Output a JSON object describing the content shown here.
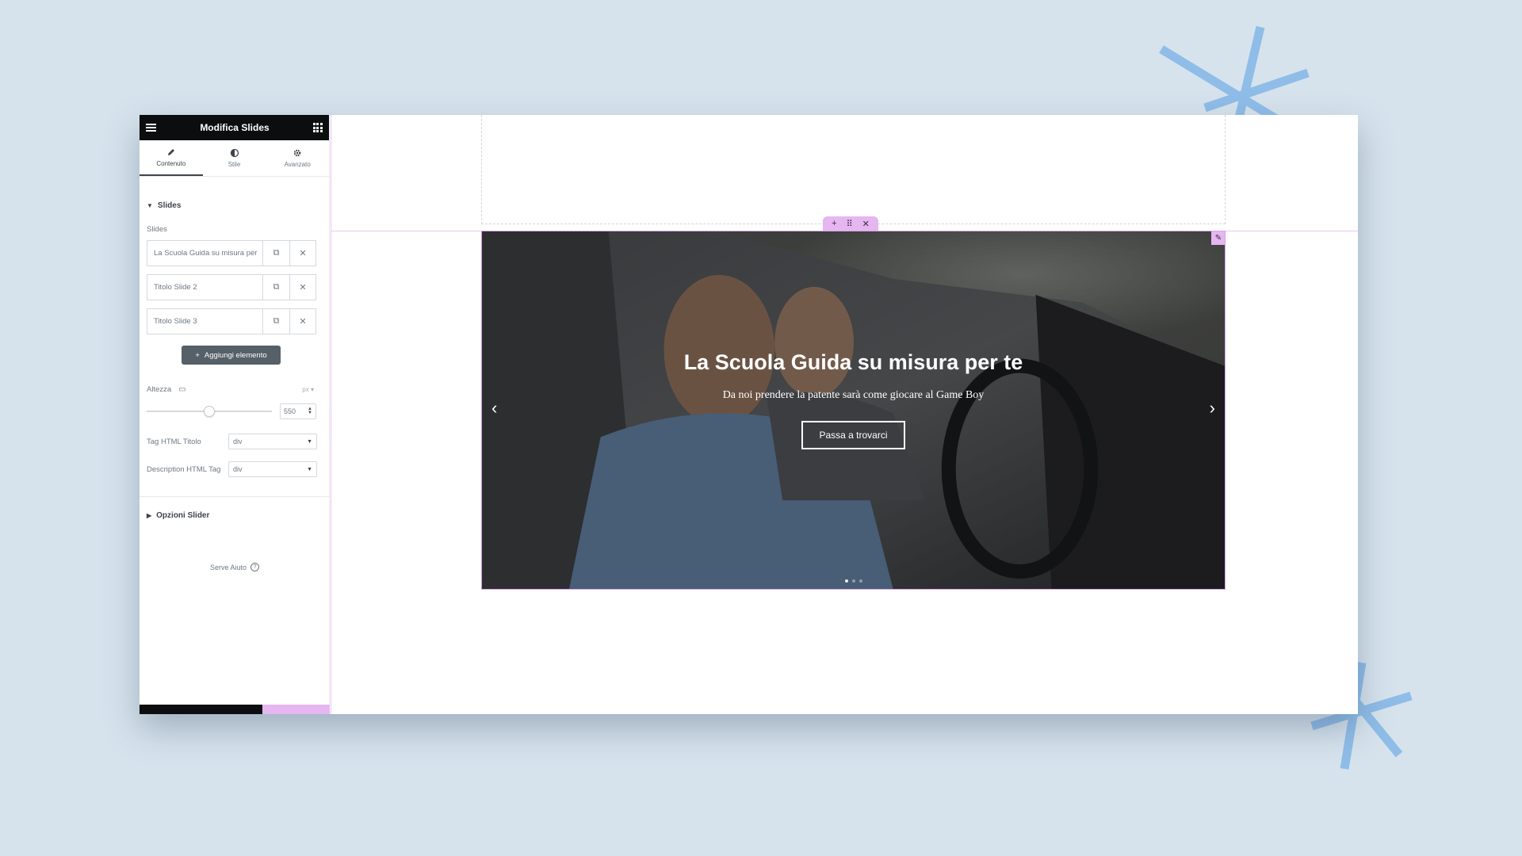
{
  "panel": {
    "title": "Modifica Slides",
    "tabs": [
      {
        "label": "Contenuto",
        "icon": "pencil-icon"
      },
      {
        "label": "Stile",
        "icon": "contrast-icon"
      },
      {
        "label": "Avanzato",
        "icon": "gear-icon"
      }
    ],
    "section_slides": "Slides",
    "slides_label": "Slides",
    "slides": [
      {
        "title": "La Scuola Guida su misura per"
      },
      {
        "title": "Titolo Slide 2"
      },
      {
        "title": "Titolo Slide 3"
      }
    ],
    "add_button": "Aggiungi elemento",
    "height_label": "Altezza",
    "height_unit": "px",
    "height_value": "550",
    "height_fraction": 0.5,
    "title_tag_label": "Tag HTML Titolo",
    "title_tag_value": "div",
    "desc_tag_label": "Description HTML Tag",
    "desc_tag_value": "div",
    "section_slider_options": "Opzioni Slider",
    "help_label": "Serve Aiuto"
  },
  "slide": {
    "heading": "La Scuola Guida su misura per te",
    "description": "Da noi prendere la patente sarà come giocare al Game Boy",
    "button": "Passa a trovarci"
  },
  "colors": {
    "accent_pink": "#e5b6f0",
    "panel_dark": "#0c0d0e",
    "background": "#d6e3ed",
    "deco_blue": "#8fbde8"
  }
}
